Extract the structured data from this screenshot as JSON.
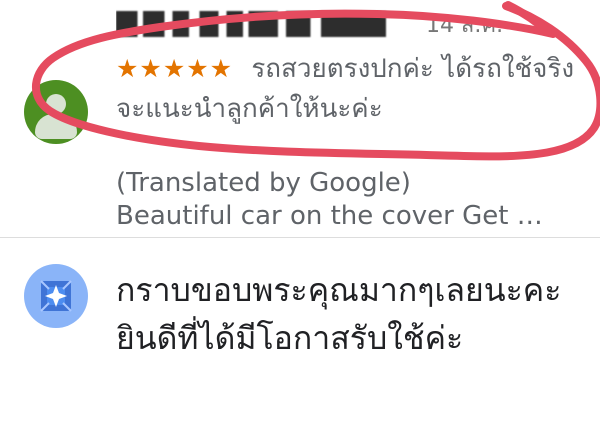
{
  "review": {
    "date": "14 ส.ค.",
    "stars": "★★★★★",
    "text": "รถสวยตรงปกค่ะ ได้รถใช้จริงจะแนะนำลูกค้าให้นะค่ะ",
    "translated_label": "(Translated by Google)",
    "translation": "Beautiful car on the cover Get …"
  },
  "owner_reply": {
    "text": "กราบขอบพระคุณมากๆเลยนะคะ ยินดีที่ได้มีโอกาสรับใช้ค่ะ"
  },
  "colors": {
    "star": "#e37400",
    "annotation": "#e54b5f",
    "review_avatar": "#4d8f22",
    "owner_logo": "#8ab4f8"
  }
}
